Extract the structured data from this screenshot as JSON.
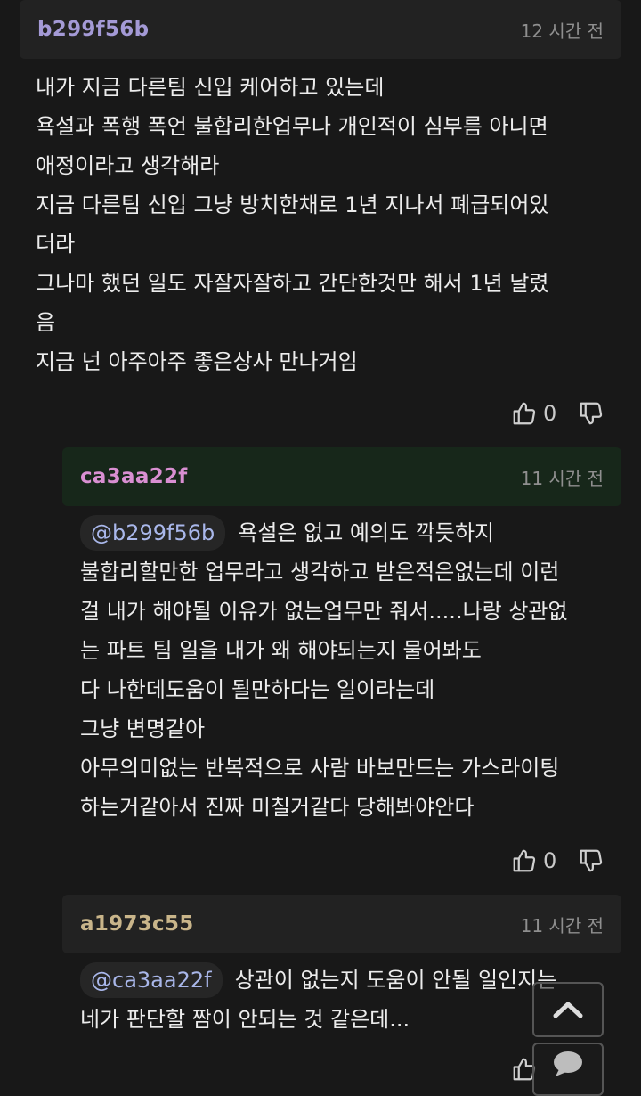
{
  "comments": [
    {
      "username": "b299f56b",
      "time": "12 시간 전",
      "lines": [
        "내가 지금 다른팀 신입 케어하고 있는데",
        "욕설과 폭행 폭언 불합리한업무나 개인적이 심부름 아니면",
        "애정이라고 생각해라",
        "지금 다른팀 신입 그냥 방치한채로 1년 지나서 폐급되어있",
        "더라",
        "그나마 했던 일도 자잘자잘하고 간단한것만 해서 1년 날렸",
        "음",
        "지금 넌 아주아주 좋은상사 만나거임"
      ],
      "likes": "0"
    },
    {
      "username": "ca3aa22f",
      "time": "11 시간 전",
      "mention": "@b299f56b",
      "first_line": "욕설은 없고 예의도 깍듯하지",
      "lines": [
        "불합리할만한 업무라고 생각하고 받은적은없는데 이런",
        "걸 내가 해야될 이유가 없는업무만 줘서.....나랑 상관없",
        "는 파트 팀 일을 내가 왜 해야되는지 물어봐도",
        "다 나한데도움이 될만하다는 일이라는데",
        "그냥 변명같아",
        "아무의미없는 반복적으로 사람 바보만드는 가스라이팅",
        "하는거같아서 진짜 미칠거같다 당해봐야안다"
      ],
      "likes": "0"
    },
    {
      "username": "a1973c55",
      "time": "11 시간 전",
      "mention": "@ca3aa22f",
      "first_line": "상관이 없는지 도움이 안될 일인지는",
      "lines": [
        "네가 판단할 짬이 안되는 것 같은데..."
      ]
    }
  ],
  "colors": {
    "username_1": "#a49ad6",
    "username_2": "#d98fd2",
    "username_3": "#c9b58a",
    "header_1_bg": "#222222",
    "header_2_bg": "#17271a",
    "header_3_bg": "#222222",
    "mention_blue": "#a9b7ea"
  },
  "icons": [
    "thumbs-up-icon",
    "thumbs-down-icon",
    "chevron-up-icon",
    "chat-bubble-icon"
  ]
}
